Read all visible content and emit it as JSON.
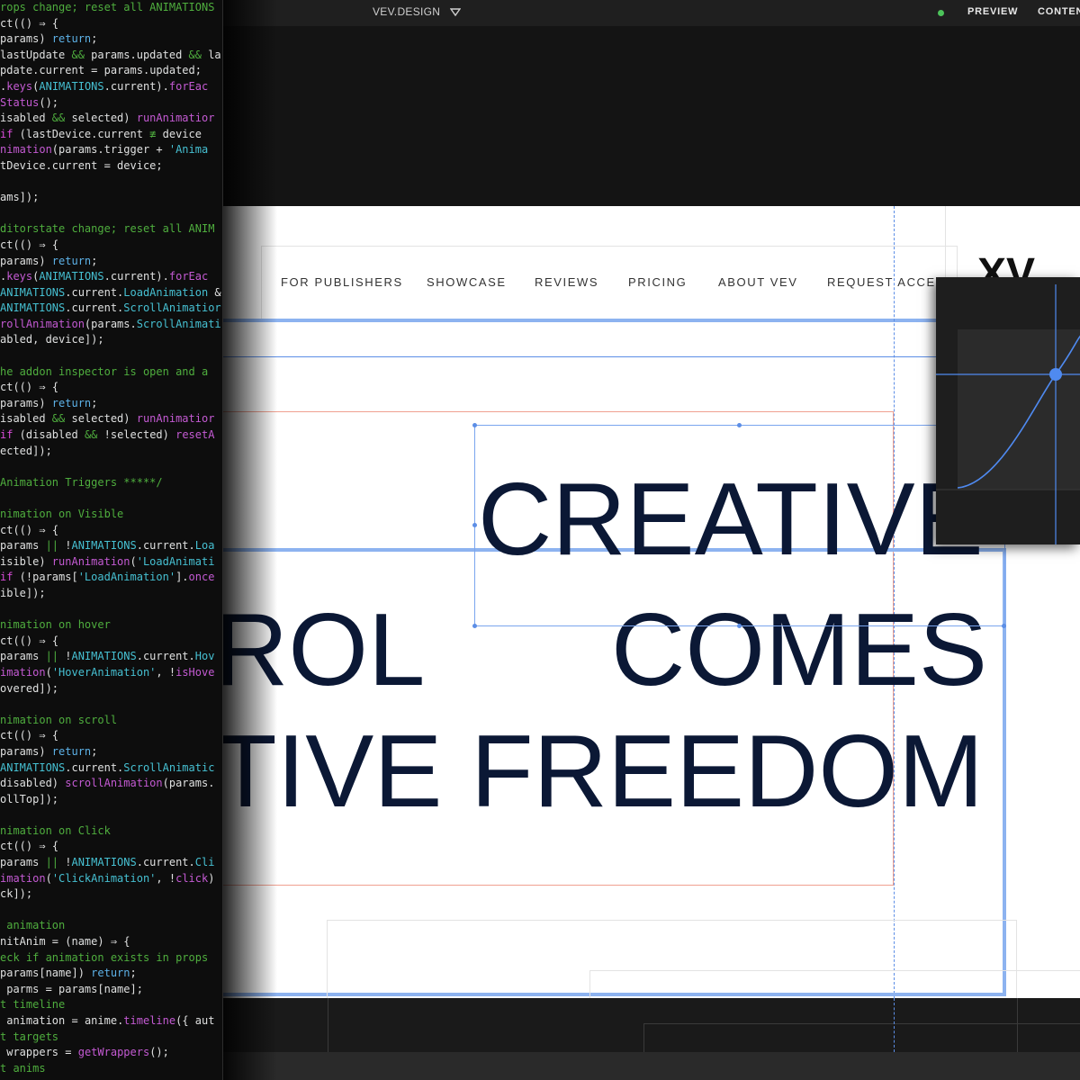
{
  "topbar": {
    "site_name": "VEV.DESIGN",
    "preview_label": "PREVIEW",
    "content_label": "CONTEN",
    "status_color": "#4cc35a"
  },
  "nav": {
    "items": [
      "FOR PUBLISHERS",
      "SHOWCASE",
      "REVIEWS",
      "PRICING",
      "ABOUT VEV",
      "REQUEST ACCESS"
    ],
    "logo_text": "XV"
  },
  "headline": {
    "line1": "CREATIVE",
    "line2_left": "ROL",
    "line2_right": "COMES",
    "line3_left": "TIVE",
    "line3_right": "FREEDOM"
  },
  "colors": {
    "selection_blue": "#8db3f0",
    "guide_red": "#f0a090",
    "headline": "#0b1835",
    "accent_blue": "#4f8af0"
  },
  "code": {
    "lines": [
      [
        [
          "c",
          "rops change; reset all ANIMATIONS"
        ]
      ],
      [
        [
          "v",
          "ct(() "
        ],
        [
          "o",
          "⇒"
        ],
        [
          "v",
          " {"
        ]
      ],
      [
        [
          "v",
          "params) "
        ],
        [
          "p",
          "return"
        ],
        [
          "v",
          ";"
        ]
      ],
      [
        [
          "v",
          "lastUpdate "
        ],
        [
          "c",
          "&&"
        ],
        [
          "v",
          " params.updated "
        ],
        [
          "c",
          "&&"
        ],
        [
          "v",
          " la"
        ]
      ],
      [
        [
          "v",
          "pdate.current "
        ],
        [
          "o",
          "="
        ],
        [
          "v",
          " params.updated;"
        ]
      ],
      [
        [
          "v",
          "."
        ],
        [
          "f",
          "keys"
        ],
        [
          "v",
          "("
        ],
        [
          "s",
          "ANIMATIONS"
        ],
        [
          "v",
          ".current)."
        ],
        [
          "f",
          "forEac"
        ]
      ],
      [
        [
          "f",
          "Status"
        ],
        [
          "v",
          "();"
        ]
      ],
      [
        [
          "v",
          "isabled "
        ],
        [
          "c",
          "&&"
        ],
        [
          "v",
          " selected) "
        ],
        [
          "f",
          "runAnimatior"
        ]
      ],
      [
        [
          "k",
          "if"
        ],
        [
          "v",
          " (lastDevice.current "
        ],
        [
          "c",
          "≢"
        ],
        [
          "v",
          " device"
        ]
      ],
      [
        [
          "f",
          "nimation"
        ],
        [
          "v",
          "(params.trigger "
        ],
        [
          "o",
          "+"
        ],
        [
          "v",
          " "
        ],
        [
          "s",
          "'Anima"
        ]
      ],
      [
        [
          "v",
          "tDevice.current "
        ],
        [
          "o",
          "="
        ],
        [
          "v",
          " device;"
        ]
      ],
      [
        [
          "v",
          ""
        ]
      ],
      [
        [
          "v",
          "ams]);"
        ]
      ],
      [
        [
          "v",
          ""
        ]
      ],
      [
        [
          "c",
          "ditorstate change; reset all ANIM"
        ]
      ],
      [
        [
          "v",
          "ct(() "
        ],
        [
          "o",
          "⇒"
        ],
        [
          "v",
          " {"
        ]
      ],
      [
        [
          "v",
          "params) "
        ],
        [
          "p",
          "return"
        ],
        [
          "v",
          ";"
        ]
      ],
      [
        [
          "v",
          "."
        ],
        [
          "f",
          "keys"
        ],
        [
          "v",
          "("
        ],
        [
          "s",
          "ANIMATIONS"
        ],
        [
          "v",
          ".current)."
        ],
        [
          "f",
          "forEac"
        ]
      ],
      [
        [
          "s",
          "ANIMATIONS"
        ],
        [
          "v",
          ".current."
        ],
        [
          "s",
          "LoadAnimation"
        ],
        [
          "v",
          " &"
        ]
      ],
      [
        [
          "s",
          "ANIMATIONS"
        ],
        [
          "v",
          ".current."
        ],
        [
          "s",
          "ScrollAnimatior"
        ]
      ],
      [
        [
          "f",
          "rollAnimation"
        ],
        [
          "v",
          "(params."
        ],
        [
          "s",
          "ScrollAnimati"
        ]
      ],
      [
        [
          "v",
          "abled, device]);"
        ]
      ],
      [
        [
          "v",
          ""
        ]
      ],
      [
        [
          "c",
          "he addon inspector is open and a"
        ]
      ],
      [
        [
          "v",
          "ct(() "
        ],
        [
          "o",
          "⇒"
        ],
        [
          "v",
          " {"
        ]
      ],
      [
        [
          "v",
          "params) "
        ],
        [
          "p",
          "return"
        ],
        [
          "v",
          ";"
        ]
      ],
      [
        [
          "v",
          "isabled "
        ],
        [
          "c",
          "&&"
        ],
        [
          "v",
          " selected) "
        ],
        [
          "f",
          "runAnimatior"
        ]
      ],
      [
        [
          "k",
          "if"
        ],
        [
          "v",
          " (disabled "
        ],
        [
          "c",
          "&&"
        ],
        [
          "v",
          " !selected) "
        ],
        [
          "f",
          "resetA"
        ]
      ],
      [
        [
          "v",
          "ected]);"
        ]
      ],
      [
        [
          "v",
          ""
        ]
      ],
      [
        [
          "c",
          "Animation Triggers *****/"
        ]
      ],
      [
        [
          "v",
          ""
        ]
      ],
      [
        [
          "c",
          "nimation on Visible"
        ]
      ],
      [
        [
          "v",
          "ct(() "
        ],
        [
          "o",
          "⇒"
        ],
        [
          "v",
          " {"
        ]
      ],
      [
        [
          "v",
          "params "
        ],
        [
          "c",
          "||"
        ],
        [
          "v",
          " !"
        ],
        [
          "s",
          "ANIMATIONS"
        ],
        [
          "v",
          ".current."
        ],
        [
          "s",
          "Loa"
        ]
      ],
      [
        [
          "v",
          "isible) "
        ],
        [
          "f",
          "runAnimation"
        ],
        [
          "v",
          "("
        ],
        [
          "s",
          "'LoadAnimati"
        ]
      ],
      [
        [
          "k",
          "if"
        ],
        [
          "v",
          " (!params["
        ],
        [
          "s",
          "'LoadAnimation'"
        ],
        [
          "v",
          "]."
        ],
        [
          "f",
          "once"
        ]
      ],
      [
        [
          "v",
          "ible]);"
        ]
      ],
      [
        [
          "v",
          ""
        ]
      ],
      [
        [
          "c",
          "nimation on hover"
        ]
      ],
      [
        [
          "v",
          "ct(() "
        ],
        [
          "o",
          "⇒"
        ],
        [
          "v",
          " {"
        ]
      ],
      [
        [
          "v",
          "params "
        ],
        [
          "c",
          "||"
        ],
        [
          "v",
          " !"
        ],
        [
          "s",
          "ANIMATIONS"
        ],
        [
          "v",
          ".current."
        ],
        [
          "s",
          "Hov"
        ]
      ],
      [
        [
          "f",
          "imation"
        ],
        [
          "v",
          "("
        ],
        [
          "s",
          "'HoverAnimation'"
        ],
        [
          "v",
          ", !"
        ],
        [
          "f",
          "isHove"
        ]
      ],
      [
        [
          "v",
          "overed]);"
        ]
      ],
      [
        [
          "v",
          ""
        ]
      ],
      [
        [
          "c",
          "nimation on scroll"
        ]
      ],
      [
        [
          "v",
          "ct(() "
        ],
        [
          "o",
          "⇒"
        ],
        [
          "v",
          " {"
        ]
      ],
      [
        [
          "v",
          "params) "
        ],
        [
          "p",
          "return"
        ],
        [
          "v",
          ";"
        ]
      ],
      [
        [
          "s",
          "ANIMATIONS"
        ],
        [
          "v",
          ".current."
        ],
        [
          "s",
          "ScrollAnimatic"
        ]
      ],
      [
        [
          "v",
          "disabled) "
        ],
        [
          "f",
          "scrollAnimation"
        ],
        [
          "v",
          "(params."
        ]
      ],
      [
        [
          "v",
          "ollTop]);"
        ]
      ],
      [
        [
          "v",
          ""
        ]
      ],
      [
        [
          "c",
          "nimation on Click"
        ]
      ],
      [
        [
          "v",
          "ct(() "
        ],
        [
          "o",
          "⇒"
        ],
        [
          "v",
          " {"
        ]
      ],
      [
        [
          "v",
          "params "
        ],
        [
          "c",
          "||"
        ],
        [
          "v",
          " !"
        ],
        [
          "s",
          "ANIMATIONS"
        ],
        [
          "v",
          ".current."
        ],
        [
          "s",
          "Cli"
        ]
      ],
      [
        [
          "f",
          "imation"
        ],
        [
          "v",
          "("
        ],
        [
          "s",
          "'ClickAnimation'"
        ],
        [
          "v",
          ", !"
        ],
        [
          "f",
          "click"
        ],
        [
          "v",
          ")"
        ]
      ],
      [
        [
          "v",
          "ck]);"
        ]
      ],
      [
        [
          "v",
          ""
        ]
      ],
      [
        [
          "c",
          " animation"
        ]
      ],
      [
        [
          "v",
          "nitAnim "
        ],
        [
          "o",
          "="
        ],
        [
          "v",
          " (name) "
        ],
        [
          "o",
          "⇒"
        ],
        [
          "v",
          " {"
        ]
      ],
      [
        [
          "c",
          "eck if animation exists in props"
        ]
      ],
      [
        [
          "v",
          "params[name]) "
        ],
        [
          "p",
          "return"
        ],
        [
          "v",
          ";"
        ]
      ],
      [
        [
          "v",
          " parms "
        ],
        [
          "o",
          "="
        ],
        [
          "v",
          " params[name];"
        ]
      ],
      [
        [
          "c",
          "t timeline"
        ]
      ],
      [
        [
          "v",
          " animation "
        ],
        [
          "o",
          "="
        ],
        [
          "v",
          " anime."
        ],
        [
          "f",
          "timeline"
        ],
        [
          "v",
          "({ aut"
        ]
      ],
      [
        [
          "c",
          "t targets"
        ]
      ],
      [
        [
          "v",
          " wrappers "
        ],
        [
          "o",
          "="
        ],
        [
          "v",
          " "
        ],
        [
          "f",
          "getWrappers"
        ],
        [
          "v",
          "();"
        ]
      ],
      [
        [
          "c",
          "t anims"
        ]
      ]
    ]
  }
}
